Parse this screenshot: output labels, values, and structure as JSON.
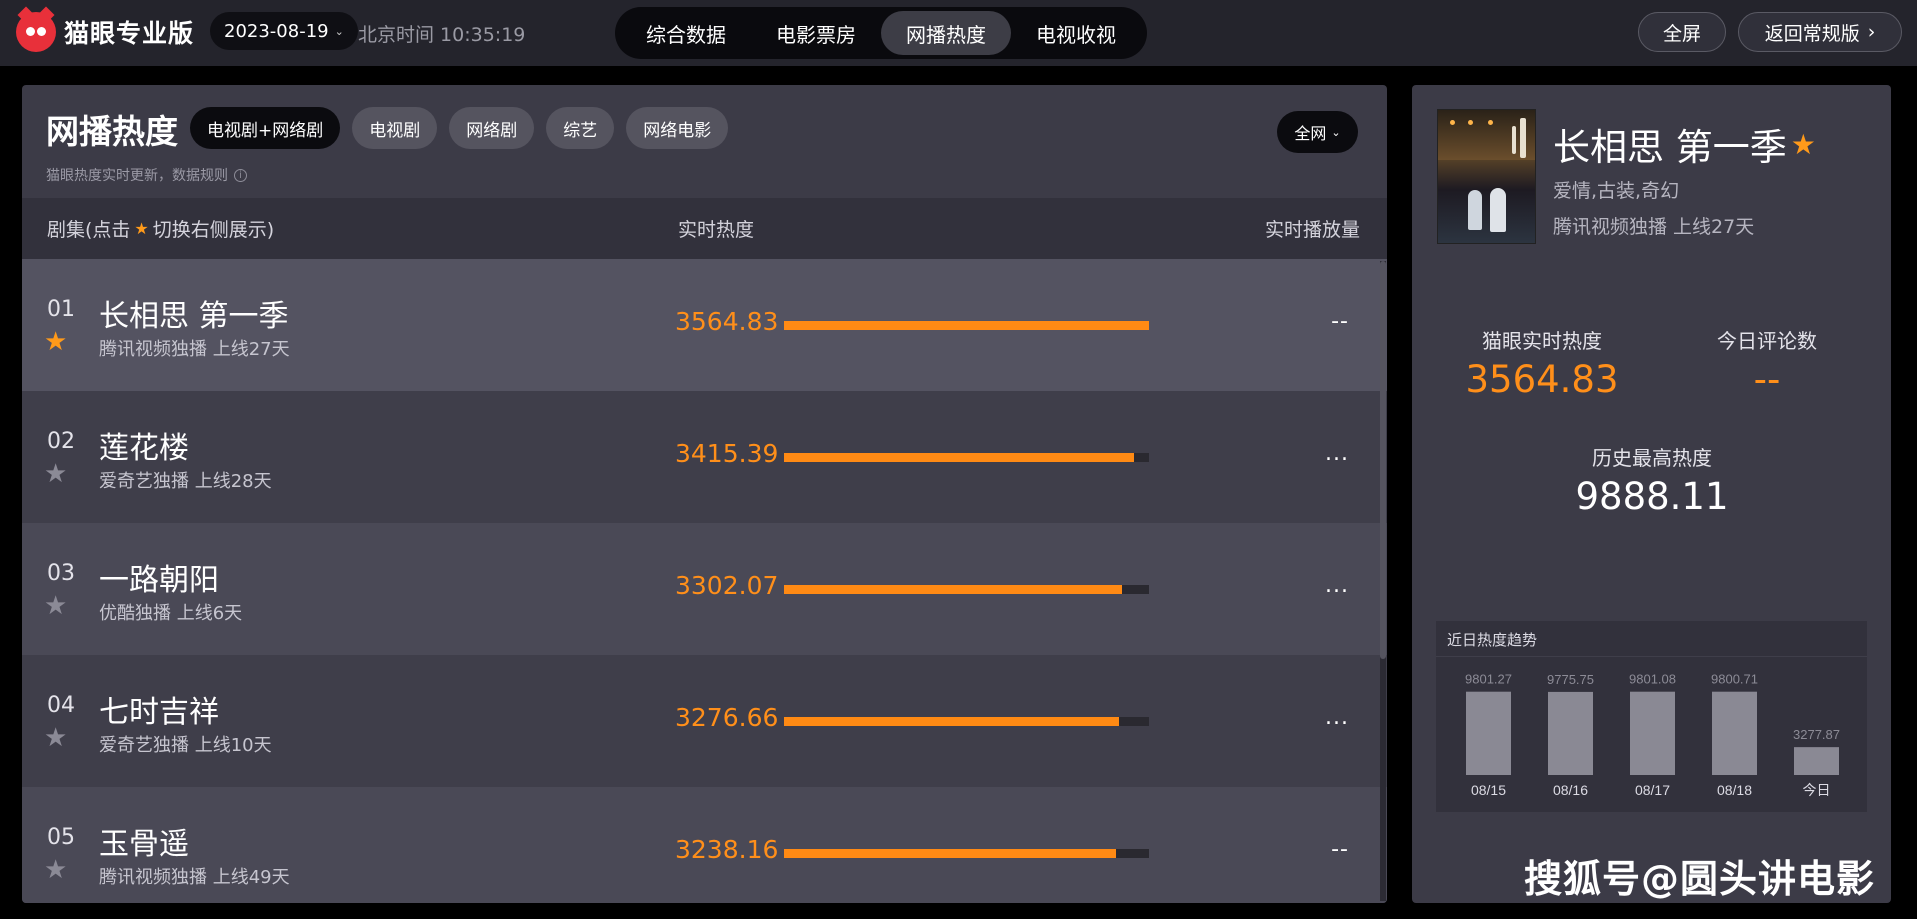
{
  "app": {
    "brand": "猫眼专业版",
    "date": "2023-08-19",
    "clock": "北京时间 10:35:19",
    "nav_tabs": [
      "综合数据",
      "电影票房",
      "网播热度",
      "电视收视"
    ],
    "active_tab": "网播热度",
    "fullscreen_label": "全屏",
    "back_label": "返回常规版"
  },
  "ranking": {
    "title": "网播热度",
    "filters": [
      "电视剧+网络剧",
      "电视剧",
      "网络剧",
      "综艺",
      "网络电影"
    ],
    "active_filter": "电视剧+网络剧",
    "region": "全网",
    "note": "猫眼热度实时更新，数据规则",
    "columns": {
      "show_prefix": "剧集(点击",
      "show_suffix": "切换右侧展示)",
      "heat": "实时热度",
      "plays": "实时播放量"
    },
    "max_heat": 3564.83,
    "rows": [
      {
        "rank": "01",
        "title": "长相思 第一季",
        "meta": "腾讯视频独播  上线27天",
        "heat": "3564.83",
        "heat_value": 3564.83,
        "plays": "--",
        "starred": true
      },
      {
        "rank": "02",
        "title": "莲花楼",
        "meta": "爱奇艺独播  上线28天",
        "heat": "3415.39",
        "heat_value": 3415.39,
        "plays": "...",
        "starred": false
      },
      {
        "rank": "03",
        "title": "一路朝阳",
        "meta": "优酷独播  上线6天",
        "heat": "3302.07",
        "heat_value": 3302.07,
        "plays": "...",
        "starred": false
      },
      {
        "rank": "04",
        "title": "七时吉祥",
        "meta": "爱奇艺独播  上线10天",
        "heat": "3276.66",
        "heat_value": 3276.66,
        "plays": "...",
        "starred": false
      },
      {
        "rank": "05",
        "title": "玉骨遥",
        "meta": "腾讯视频独播  上线49天",
        "heat": "3238.16",
        "heat_value": 3238.16,
        "plays": "--",
        "starred": false
      }
    ]
  },
  "detail": {
    "title": "长相思 第一季",
    "genre": "爱情,古装,奇幻",
    "platform": "腾讯视频独播  上线27天",
    "realtime_heat_label": "猫眼实时热度",
    "realtime_heat": "3564.83",
    "comments_label": "今日评论数",
    "comments": "--",
    "peak_label": "历史最高热度",
    "peak": "9888.11",
    "trend_title": "近日热度趋势"
  },
  "chart_data": {
    "type": "bar",
    "categories": [
      "08/15",
      "08/16",
      "08/17",
      "08/18",
      "今日"
    ],
    "values": [
      9801.27,
      9775.75,
      9801.08,
      9800.71,
      3277.87
    ],
    "labels": [
      "9801.27",
      "9775.75",
      "9801.08",
      "9800.71",
      "3277.87"
    ],
    "title": "近日热度趋势",
    "bar_color": "#8a8994"
  },
  "watermark": "搜狐号@圆头讲电影",
  "colors": {
    "accent": "#ff8f1a",
    "panel": "#3c3b47",
    "topbar": "#24242c"
  }
}
